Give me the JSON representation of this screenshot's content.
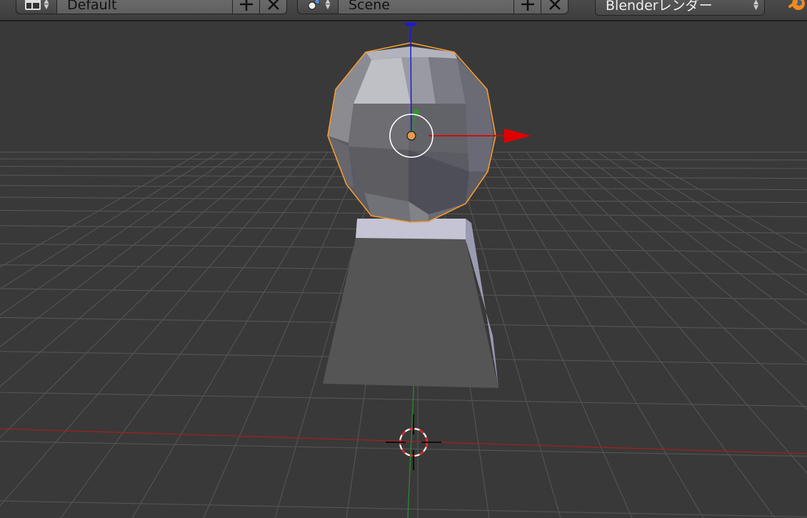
{
  "header": {
    "screen_layout": {
      "value": "Default",
      "icon": "screen-layout-icon"
    },
    "scene": {
      "value": "Scene",
      "icon": "scene-icon"
    },
    "render_engine": {
      "value": "Blenderレンダー"
    },
    "icons": {
      "add": "plus-icon",
      "remove": "x-icon",
      "logo": "blender-logo-icon"
    }
  },
  "viewport": {
    "background": "#393939",
    "selection_outline": "#f39b32",
    "axis_x_color": "#a02020",
    "axis_y_color": "#2a8a2a",
    "gizmo_x": "#e00000",
    "gizmo_z": "#1a1ad8"
  }
}
